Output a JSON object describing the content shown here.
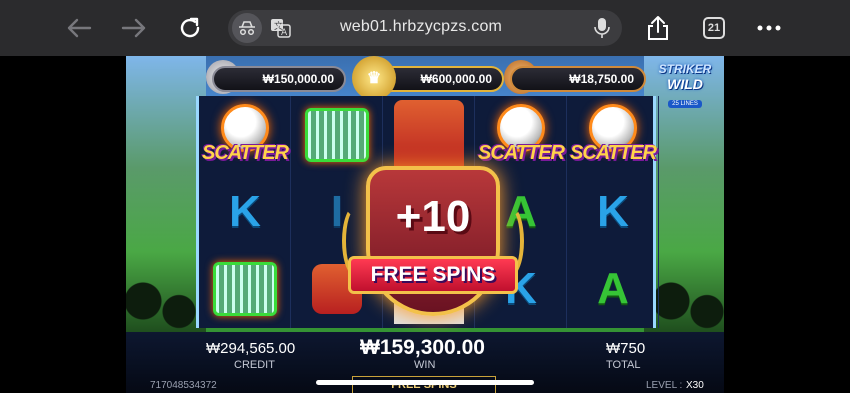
{
  "browser": {
    "url": "web01.hrbzycpzs.com",
    "tab_count": "21",
    "icons": [
      "back-arrow-icon",
      "forward-arrow-icon",
      "reload-icon",
      "incognito-icon",
      "translate-icon",
      "microphone-icon",
      "share-icon",
      "tabs-icon",
      "more-icon"
    ]
  },
  "jackpots": {
    "silver": "₩150,000.00",
    "gold": "₩600,000.00",
    "bronze": "₩18,750.00"
  },
  "logo": {
    "line1": "STRIKER",
    "line2": "WILD",
    "lines": "25 LINES"
  },
  "reels": {
    "scatter_label": "SCATTER",
    "k": "K",
    "a": "A",
    "faded_i": "I"
  },
  "bonus": {
    "amount": "+10",
    "label": "FREE SPINS"
  },
  "hud": {
    "credit_value": "₩294,565.00",
    "credit_label": "CREDIT",
    "win_value": "₩159,300.00",
    "win_label": "WIN",
    "total_value": "₩750",
    "total_label": "TOTAL",
    "free_spins_strip": "FREE SPINS",
    "round_id": "717048534372",
    "level_label": "LEVEL :",
    "level_value": "X30"
  }
}
